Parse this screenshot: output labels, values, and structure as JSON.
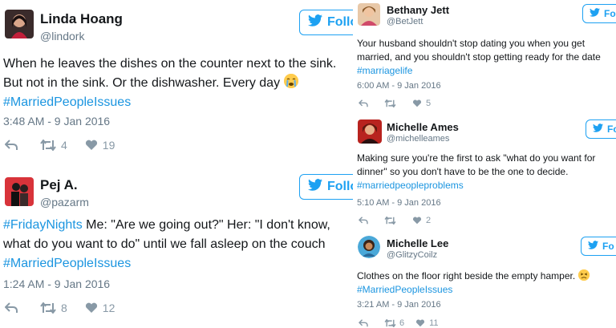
{
  "left_column": {
    "tweets": [
      {
        "name": "Linda Hoang",
        "handle": "@lindork",
        "follow_label": "Follo",
        "text": "When he leaves the dishes on the counter next to the sink.\nBut not in the sink. Or the dishwasher. Every day",
        "hashtag": "#MarriedPeopleIssues",
        "timestamp": "3:48 AM - 9 Jan 2016",
        "retweets": "4",
        "likes": "19",
        "emoji": "crying-face"
      },
      {
        "name": "Pej A.",
        "handle": "@pazarm",
        "follow_label": "Follo",
        "hashtag_lead": "#FridayNights",
        "text": " Me: \"Are we going out?\" Her: \"I don't know,\nwhat do you want to do\" until we fall asleep on the couch",
        "hashtag": "#MarriedPeopleIssues",
        "timestamp": "1:24 AM - 9 Jan 2016",
        "retweets": "8",
        "likes": "12"
      }
    ]
  },
  "right_column": {
    "tweets": [
      {
        "name": "Bethany Jett",
        "handle": "@BetJett",
        "follow_label": "Fo",
        "text": "Your husband shouldn't stop dating you when you get\nmarried, and you shouldn't stop getting ready for the date",
        "hashtag": "#marriagelife",
        "timestamp": "6:00 AM - 9 Jan 2016",
        "retweets": "",
        "likes": "5"
      },
      {
        "name": "Michelle Ames",
        "handle": "@michelleames",
        "follow_label": "Fo",
        "text": "Making sure you're the first to ask \"what do you want for\ndinner\" so you don't have to be the one to decide.",
        "hashtag": "#marriedpeopleproblems",
        "timestamp": "5:10 AM - 9 Jan 2016",
        "retweets": "",
        "likes": "2"
      },
      {
        "name": "Michelle Lee",
        "handle": "@GlitzyCoilz",
        "follow_label": "Fo",
        "text": "Clothes on the floor right beside the empty hamper.",
        "hashtag": "#MarriedPeopleIssues",
        "timestamp": "3:21 AM - 9 Jan 2016",
        "retweets": "6",
        "likes": "11",
        "emoji": "persevering-face"
      }
    ]
  },
  "colors": {
    "twitter_blue": "#1da1f2",
    "hashtag_blue": "#1b95e0",
    "muted_gray": "#657786",
    "icon_gray": "#8899a6"
  },
  "icons": [
    "reply-icon",
    "retweet-icon",
    "heart-icon",
    "twitter-bird-icon"
  ]
}
